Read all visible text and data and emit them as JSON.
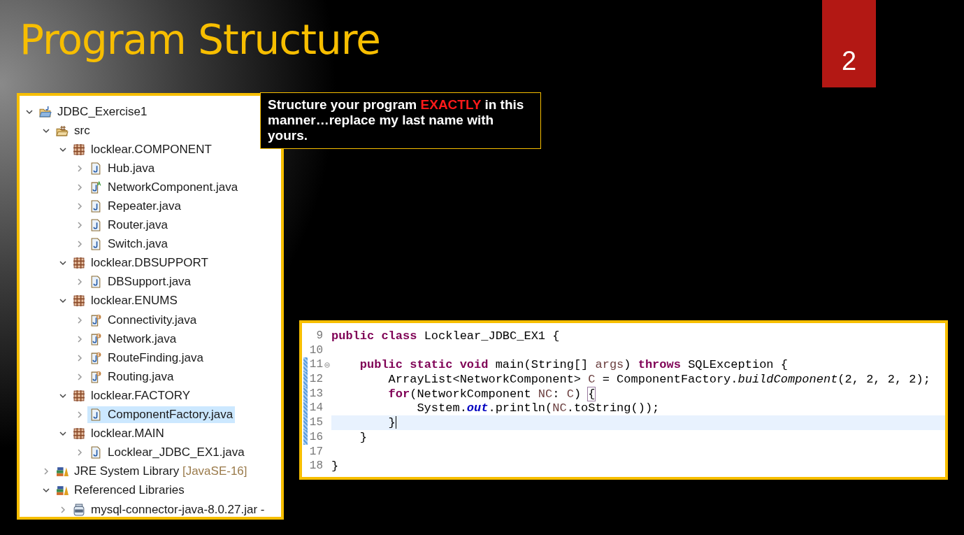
{
  "slide": {
    "title": "Program Structure",
    "number": "2"
  },
  "callout": {
    "parts": [
      {
        "text": "Structure your program ",
        "emphasis": false
      },
      {
        "text": "EXACTLY",
        "emphasis": true
      },
      {
        "text": " in this manner…replace my last name with yours.",
        "emphasis": false
      }
    ]
  },
  "project_tree": [
    {
      "label": "JDBC_Exercise1",
      "kind": "project",
      "expanded": true,
      "selected": false,
      "children": [
        {
          "label": "src",
          "kind": "source-folder",
          "expanded": true,
          "selected": false,
          "children": [
            {
              "label": "locklear.COMPONENT",
              "kind": "package",
              "expanded": true,
              "selected": false,
              "children": [
                {
                  "label": "Hub.java",
                  "kind": "class",
                  "expanded": false,
                  "selected": false
                },
                {
                  "label": "NetworkComponent.java",
                  "kind": "abstract-class",
                  "expanded": false,
                  "selected": false
                },
                {
                  "label": "Repeater.java",
                  "kind": "class",
                  "expanded": false,
                  "selected": false
                },
                {
                  "label": "Router.java",
                  "kind": "class",
                  "expanded": false,
                  "selected": false
                },
                {
                  "label": "Switch.java",
                  "kind": "class",
                  "expanded": false,
                  "selected": false
                }
              ]
            },
            {
              "label": "locklear.DBSUPPORT",
              "kind": "package",
              "expanded": true,
              "selected": false,
              "children": [
                {
                  "label": "DBSupport.java",
                  "kind": "class",
                  "expanded": false,
                  "selected": false
                }
              ]
            },
            {
              "label": "locklear.ENUMS",
              "kind": "package",
              "expanded": true,
              "selected": false,
              "children": [
                {
                  "label": "Connectivity.java",
                  "kind": "enum",
                  "expanded": false,
                  "selected": false
                },
                {
                  "label": "Network.java",
                  "kind": "enum",
                  "expanded": false,
                  "selected": false
                },
                {
                  "label": "RouteFinding.java",
                  "kind": "enum",
                  "expanded": false,
                  "selected": false
                },
                {
                  "label": "Routing.java",
                  "kind": "enum",
                  "expanded": false,
                  "selected": false
                }
              ]
            },
            {
              "label": "locklear.FACTORY",
              "kind": "package",
              "expanded": true,
              "selected": false,
              "children": [
                {
                  "label": "ComponentFactory.java",
                  "kind": "class",
                  "expanded": false,
                  "selected": true
                }
              ]
            },
            {
              "label": "locklear.MAIN",
              "kind": "package",
              "expanded": true,
              "selected": false,
              "children": [
                {
                  "label": "Locklear_JDBC_EX1.java",
                  "kind": "class",
                  "expanded": false,
                  "selected": false
                }
              ]
            }
          ]
        },
        {
          "label": "JRE System Library",
          "suffix": "[JavaSE-16]",
          "kind": "library",
          "expanded": false,
          "selected": false
        },
        {
          "label": "Referenced Libraries",
          "kind": "library",
          "expanded": true,
          "selected": false,
          "children": [
            {
              "label": "mysql-connector-java-8.0.27.jar -",
              "kind": "jar",
              "expanded": false,
              "selected": false
            }
          ]
        }
      ]
    }
  ],
  "code_editor": {
    "lines": [
      {
        "number": "9",
        "changed": false,
        "fold": false,
        "current": false,
        "tokens": [
          {
            "text": "public",
            "kind": "keyword"
          },
          {
            "text": " class",
            "kind": "keyword"
          },
          {
            "text": " Locklear_JDBC_EX1 {",
            "kind": "plain"
          }
        ]
      },
      {
        "number": "10",
        "changed": false,
        "fold": false,
        "current": false
      },
      {
        "number": "11",
        "changed": true,
        "fold": true,
        "current": false,
        "tokens": [
          {
            "text": "    public",
            "kind": "keyword"
          },
          {
            "text": " static",
            "kind": "keyword"
          },
          {
            "text": " void",
            "kind": "keyword"
          },
          {
            "text": " main(String[] ",
            "kind": "plain"
          },
          {
            "text": "args",
            "kind": "local"
          },
          {
            "text": ") ",
            "kind": "plain"
          },
          {
            "text": "throws",
            "kind": "keyword"
          },
          {
            "text": " SQLException {",
            "kind": "plain"
          }
        ]
      },
      {
        "number": "12",
        "changed": true,
        "fold": false,
        "current": false,
        "tokens": [
          {
            "text": "        ArrayList<NetworkComponent> ",
            "kind": "plain"
          },
          {
            "text": "C",
            "kind": "local"
          },
          {
            "text": " = ComponentFactory.",
            "kind": "plain"
          },
          {
            "text": "buildComponent",
            "kind": "static-method"
          },
          {
            "text": "(2, 2, 2, 2);",
            "kind": "plain"
          }
        ]
      },
      {
        "number": "13",
        "changed": true,
        "fold": false,
        "current": false,
        "tokens": [
          {
            "text": "        for",
            "kind": "keyword"
          },
          {
            "text": "(NetworkComponent ",
            "kind": "plain"
          },
          {
            "text": "NC",
            "kind": "local"
          },
          {
            "text": ": ",
            "kind": "plain"
          },
          {
            "text": "C",
            "kind": "local"
          },
          {
            "text": ") ",
            "kind": "plain"
          },
          {
            "text": "{",
            "kind": "matched-bracket"
          }
        ]
      },
      {
        "number": "14",
        "changed": true,
        "fold": false,
        "current": false,
        "tokens": [
          {
            "text": "            System.",
            "kind": "plain"
          },
          {
            "text": "out",
            "kind": "static-field"
          },
          {
            "text": ".println(",
            "kind": "plain"
          },
          {
            "text": "NC",
            "kind": "local"
          },
          {
            "text": ".toString());",
            "kind": "plain"
          }
        ]
      },
      {
        "number": "15",
        "changed": true,
        "fold": false,
        "current": true,
        "tokens": [
          {
            "text": "        }",
            "kind": "plain"
          }
        ]
      },
      {
        "number": "16",
        "changed": true,
        "fold": false,
        "current": false,
        "tokens": [
          {
            "text": "    }",
            "kind": "plain"
          }
        ]
      },
      {
        "number": "17",
        "changed": false,
        "fold": false,
        "current": false
      },
      {
        "number": "18",
        "changed": false,
        "fold": false,
        "current": false,
        "tokens": [
          {
            "text": "}",
            "kind": "plain"
          }
        ]
      }
    ]
  }
}
